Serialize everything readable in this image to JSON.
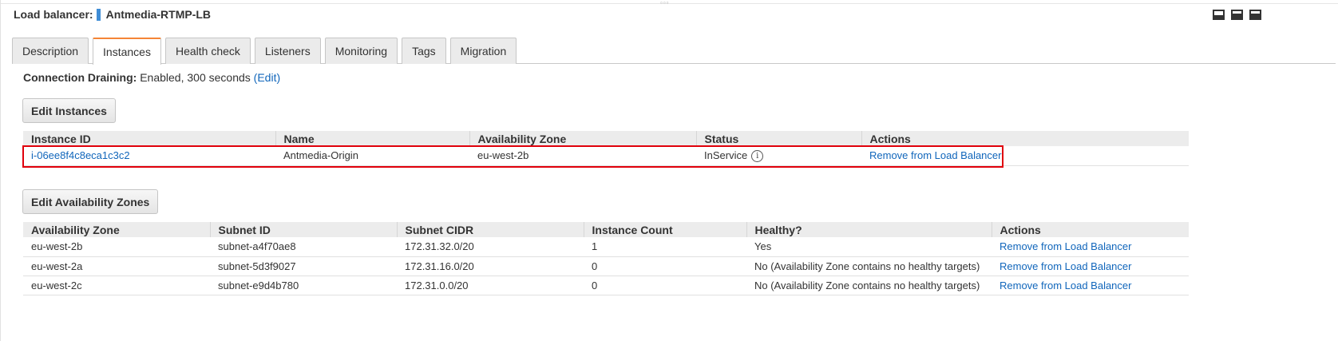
{
  "header": {
    "label": "Load balancer:",
    "name": "Antmedia-RTMP-LB",
    "color": "#3f8dd6"
  },
  "tabs": [
    {
      "label": "Description"
    },
    {
      "label": "Instances"
    },
    {
      "label": "Health check"
    },
    {
      "label": "Listeners"
    },
    {
      "label": "Monitoring"
    },
    {
      "label": "Tags"
    },
    {
      "label": "Migration"
    }
  ],
  "active_tab": "Instances",
  "connection_draining": {
    "label": "Connection Draining:",
    "value": "Enabled, 300 seconds",
    "edit_label": "(Edit)"
  },
  "edit_instances_label": "Edit Instances",
  "instances_table": {
    "headers": [
      "Instance ID",
      "Name",
      "Availability Zone",
      "Status",
      "Actions"
    ],
    "rows": [
      {
        "id": "i-06ee8f4c8eca1c3c2",
        "name": "Antmedia-Origin",
        "zone": "eu-west-2b",
        "status": "InService",
        "status_icon": "info-icon",
        "action": "Remove from Load Balancer"
      }
    ]
  },
  "edit_zones_label": "Edit Availability Zones",
  "zones_table": {
    "headers": [
      "Availability Zone",
      "Subnet ID",
      "Subnet CIDR",
      "Instance Count",
      "Healthy?",
      "Actions"
    ],
    "rows": [
      {
        "zone": "eu-west-2b",
        "subnet": "subnet-a4f70ae8",
        "cidr": "172.31.32.0/20",
        "count": "1",
        "healthy": "Yes",
        "action": "Remove from Load Balancer"
      },
      {
        "zone": "eu-west-2a",
        "subnet": "subnet-5d3f9027",
        "cidr": "172.31.16.0/20",
        "count": "0",
        "healthy": "No (Availability Zone contains no healthy targets)",
        "action": "Remove from Load Balancer"
      },
      {
        "zone": "eu-west-2c",
        "subnet": "subnet-e9d4b780",
        "cidr": "172.31.0.0/20",
        "count": "0",
        "healthy": "No (Availability Zone contains no healthy targets)",
        "action": "Remove from Load Balancer"
      }
    ]
  },
  "colors": {
    "accent_tab": "#f58536",
    "link": "#1166bb",
    "highlight": "#e0000b"
  }
}
